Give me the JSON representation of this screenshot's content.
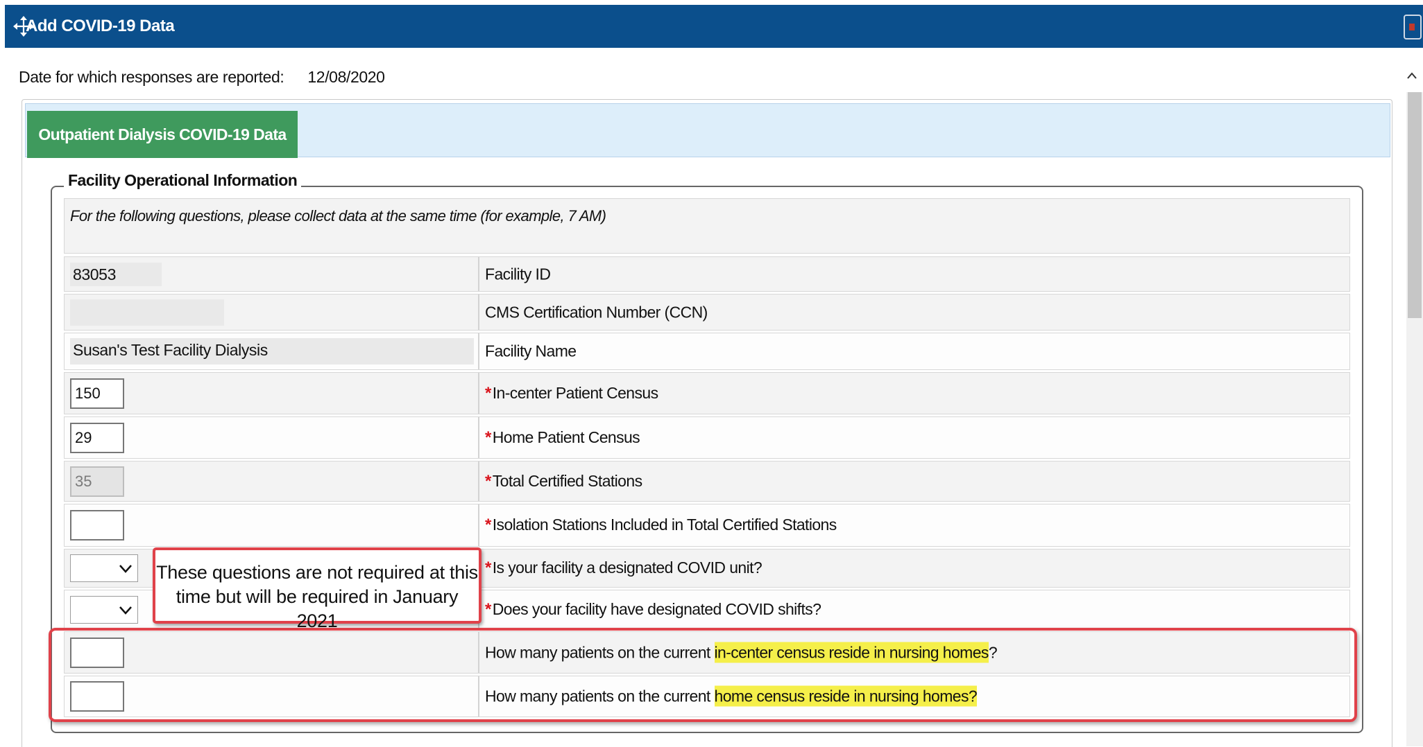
{
  "window": {
    "title": "Add COVID-19 Data"
  },
  "report": {
    "date_label": "Date for which responses are reported:",
    "date_value": "12/08/2020"
  },
  "tabs": [
    {
      "label": "Outpatient Dialysis COVID-19 Data",
      "active": true
    }
  ],
  "section": {
    "legend": "Facility Operational Information",
    "instructions": "For the following questions, please collect data at the same time (for example, 7 AM)"
  },
  "rows": [
    {
      "value": "83053",
      "label": "Facility ID",
      "required": false
    },
    {
      "value": "",
      "label": "CMS Certification Number (CCN)",
      "required": false
    },
    {
      "value": "Susan's Test Facility Dialysis",
      "label": "Facility Name",
      "required": false
    },
    {
      "value": "150",
      "label": "In-center Patient Census",
      "required": true
    },
    {
      "value": "29",
      "label": "Home Patient Census",
      "required": true
    },
    {
      "value": "35",
      "label": "Total Certified Stations",
      "required": true
    },
    {
      "value": "",
      "label": "Isolation Stations Included in Total Certified Stations",
      "required": true
    },
    {
      "value": "",
      "label": "Is your facility a designated COVID unit?",
      "required": true
    },
    {
      "value": "",
      "label": "Does your facility have designated COVID shifts?",
      "required": true
    },
    {
      "value": "",
      "label_prefix": "How many patients on the current ",
      "label_highlight": "in-center census reside in nursing homes",
      "label_suffix": "?",
      "required": false
    },
    {
      "value": "",
      "label_prefix": "How many patients on the current ",
      "label_highlight": "home census reside in nursing homes?",
      "label_suffix": "",
      "required": false
    }
  ],
  "required_marker": "*",
  "callout": {
    "text": "These questions are not required at this time but will be required in January 2021"
  },
  "colors": {
    "titlebar": "#0b4f8c",
    "tab_active": "#3f9a5d",
    "annotation": "#e0424a",
    "highlight": "#f5ef4a",
    "required": "#d9141c"
  },
  "icons": {
    "move": "move-arrows-icon",
    "close": "close-icon",
    "scroll_up": "chevron-up-icon",
    "dropdown": "chevron-down-icon"
  }
}
